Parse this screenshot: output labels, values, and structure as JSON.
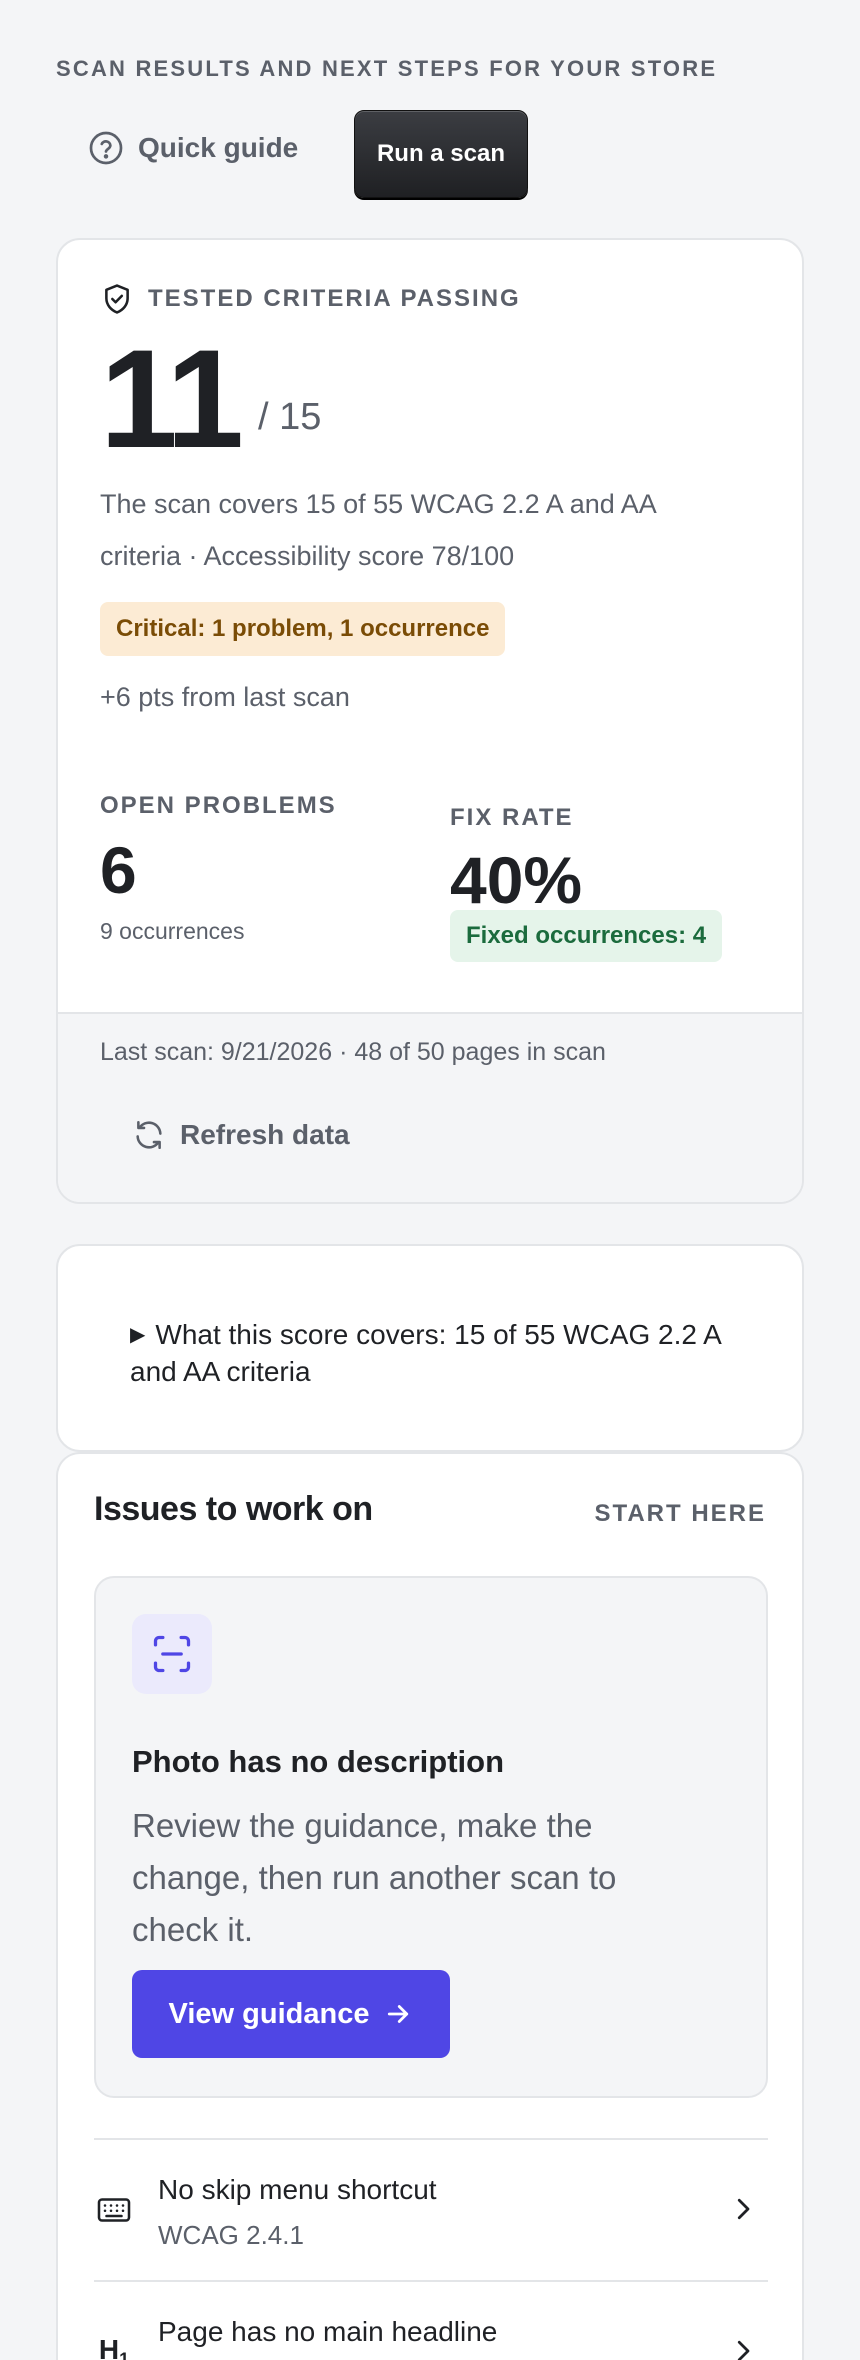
{
  "header": {
    "eyebrow": "SCAN RESULTS AND NEXT STEPS FOR YOUR STORE",
    "quick_guide_label": "Quick guide",
    "run_scan_label": "Run a scan"
  },
  "score_card": {
    "heading": "TESTED CRITERIA PASSING",
    "passing": "11",
    "total": "/ 15",
    "description": "The scan covers 15 of 55 WCAG 2.2 A and AA criteria · Accessibility score 78/100",
    "critical_badge": "Critical: 1 problem, 1 occurrence",
    "delta": "+6 pts from last scan",
    "open_problems_label": "OPEN PROBLEMS",
    "open_problems_value": "6",
    "occurrences": "9 occurrences",
    "fix_rate_label": "FIX RATE",
    "fix_rate_value": "40%",
    "fixed_badge": "Fixed occurrences: 4",
    "last_scan": "Last scan: 9/21/2026 · 48 of 50 pages in scan",
    "refresh_label": "Refresh data"
  },
  "details": {
    "summary": "What this score covers: 15 of 55 WCAG 2.2 A and AA criteria"
  },
  "issues": {
    "title": "Issues to work on",
    "start_here": "START HERE",
    "featured": {
      "title": "Photo has no description",
      "description": "Review the guidance, make the change, then run another scan to check it.",
      "button_label": "View guidance"
    },
    "rows": [
      {
        "title": "No skip menu shortcut",
        "sub": "WCAG 2.4.1",
        "icon": "keyboard-icon"
      },
      {
        "title": "Page has no main headline",
        "sub": "",
        "icon": "heading-h1-icon"
      }
    ]
  },
  "colors": {
    "accent": "#4f46e5",
    "critical_bg": "#fcebd4",
    "success_bg": "#e5f4ea"
  }
}
